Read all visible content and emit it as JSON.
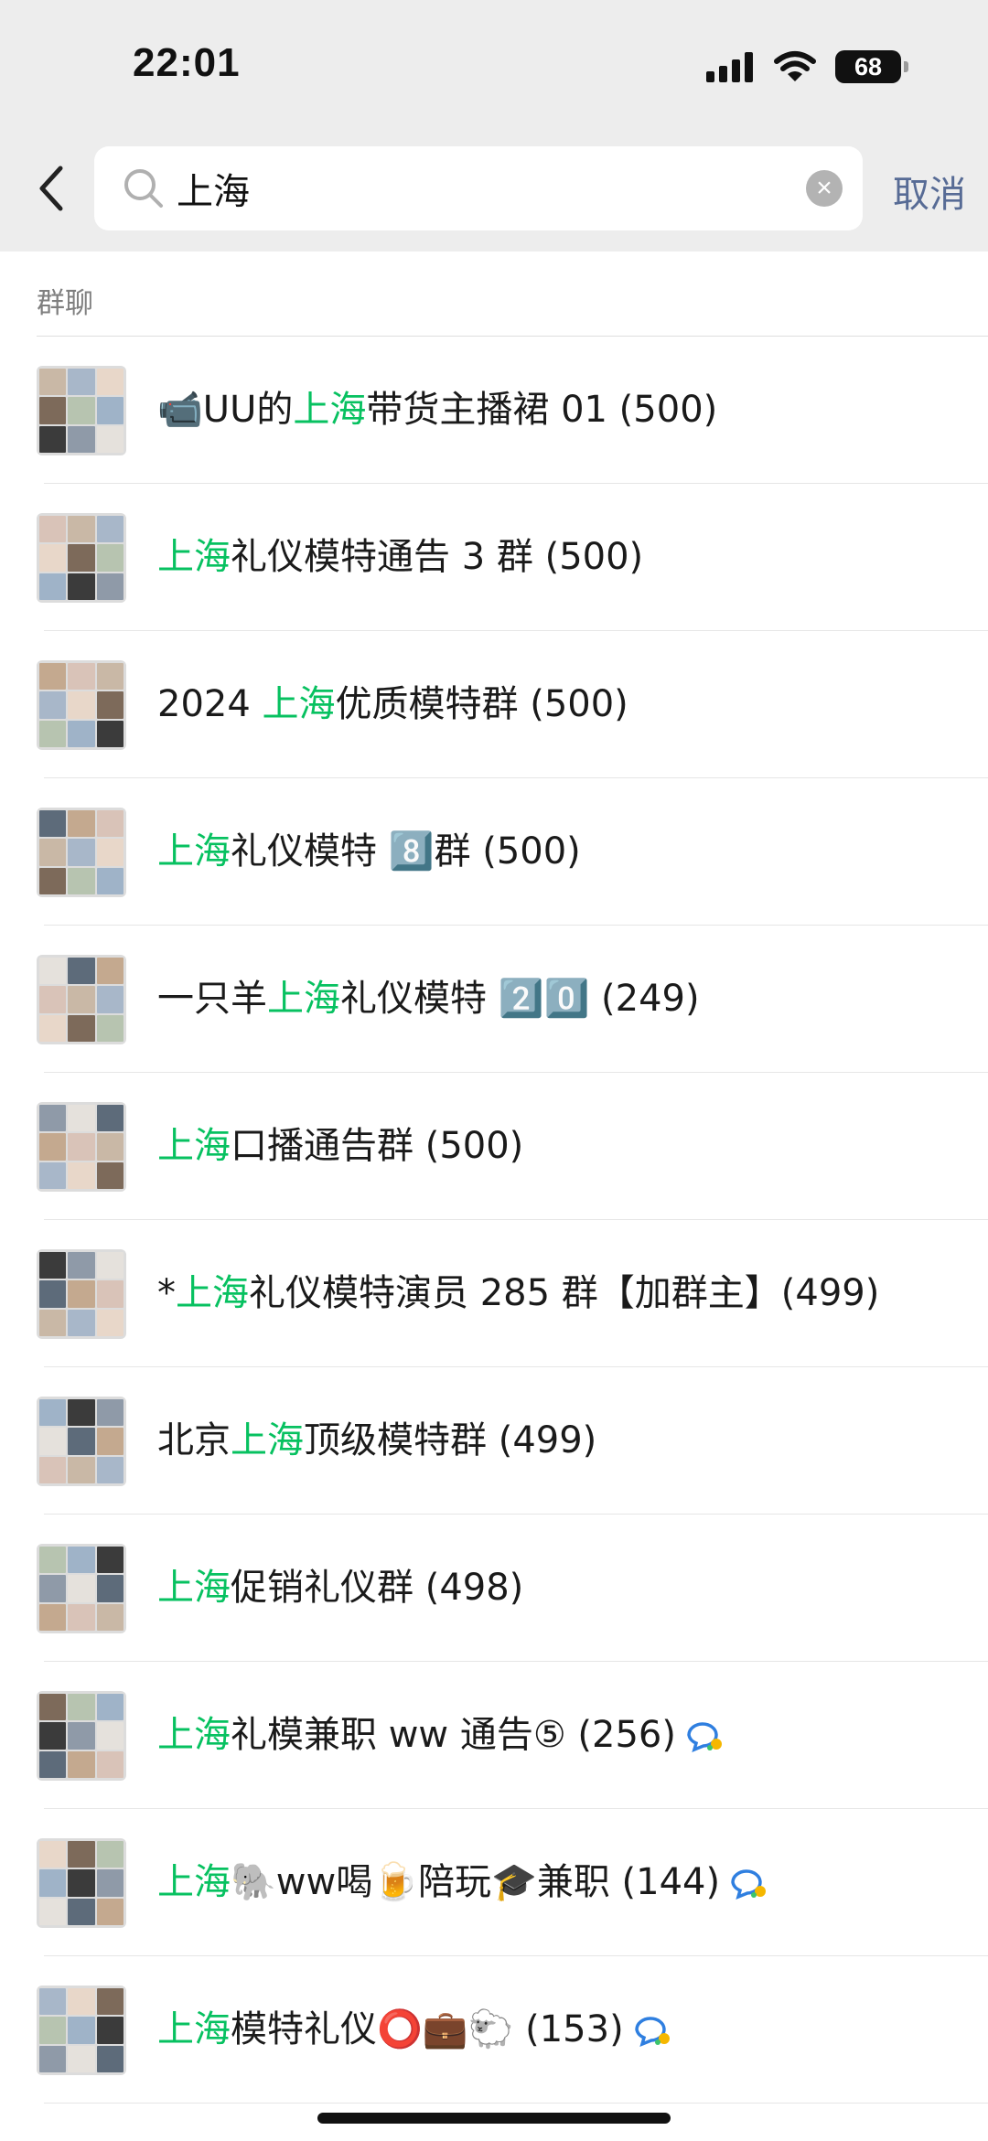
{
  "status_bar": {
    "time": "22:01",
    "battery": "68"
  },
  "search": {
    "query": "上海",
    "cancel_label": "取消"
  },
  "section": {
    "title": "群聊"
  },
  "colors": {
    "highlight": "#07c160",
    "link": "#576b95",
    "header_bg": "#ededed"
  },
  "groups": [
    {
      "before": "📹UU的",
      "match": "上海",
      "after": "带货主播裙 01 (500)",
      "badge": false
    },
    {
      "before": "",
      "match": "上海",
      "after": "礼仪模特通告 3 群 (500)",
      "badge": false
    },
    {
      "before": "2024 ",
      "match": "上海",
      "after": "优质模特群 (500)",
      "badge": false
    },
    {
      "before": "",
      "match": "上海",
      "after": "礼仪模特 8️⃣群 (500)",
      "badge": false
    },
    {
      "before": "一只羊",
      "match": "上海",
      "after": "礼仪模特 2️⃣0️⃣ (249)",
      "badge": false
    },
    {
      "before": "",
      "match": "上海",
      "after": "口播通告群 (500)",
      "badge": false
    },
    {
      "before": "*",
      "match": "上海",
      "after": "礼仪模特演员 285 群【加群主】(499)",
      "badge": false
    },
    {
      "before": "北京",
      "match": "上海",
      "after": "顶级模特群 (499)",
      "badge": false
    },
    {
      "before": "",
      "match": "上海",
      "after": "促销礼仪群 (498)",
      "badge": false
    },
    {
      "before": "",
      "match": "上海",
      "after": "礼模兼职 ww 通告⑤ (256)",
      "badge": true
    },
    {
      "before": "",
      "match": "上海",
      "after": "🐘ww喝🍺陪玩🎓兼职 (144)",
      "badge": true
    },
    {
      "before": "",
      "match": "上海",
      "after": "模特礼仪⭕💼🐑 (153)",
      "badge": true
    }
  ]
}
